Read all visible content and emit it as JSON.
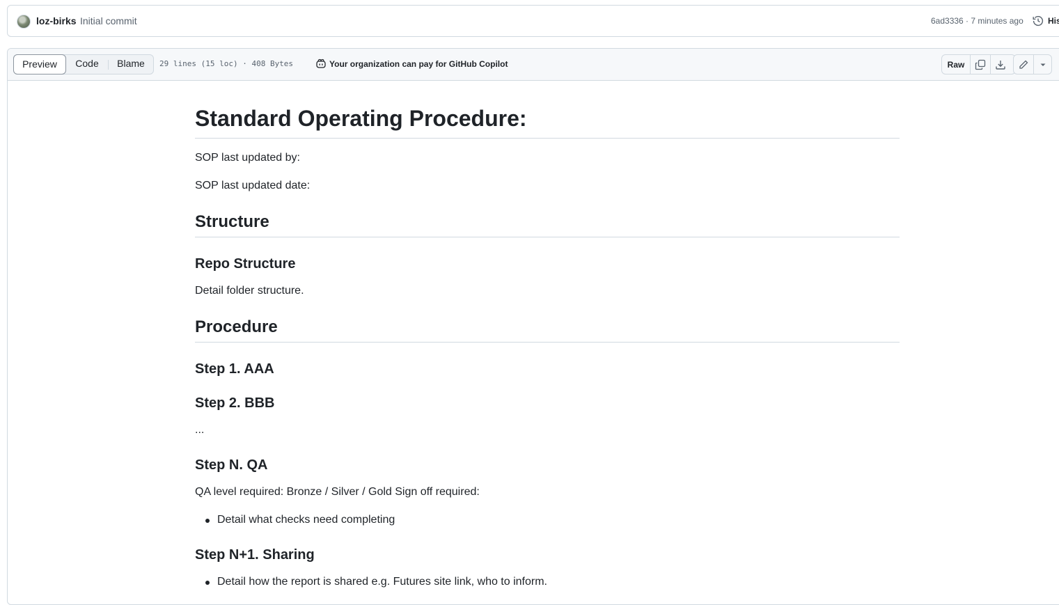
{
  "commit": {
    "author": "loz-birks",
    "message": "Initial commit",
    "meta": "6ad3336 · 7 minutes ago",
    "history_label": "History"
  },
  "file_header": {
    "tabs": [
      "Preview",
      "Code",
      "Blame"
    ],
    "active_tab": "Preview",
    "info": "29 lines (15 loc) · 408 Bytes",
    "copilot_text": "Your organization can pay for GitHub Copilot",
    "raw_label": "Raw",
    "icons": [
      "copy-icon",
      "download-icon",
      "pencil-icon",
      "triangle-down-icon"
    ]
  },
  "doc": {
    "title": "Standard Operating Procedure:",
    "updated_by": "SOP last updated by:",
    "updated_date": "SOP last updated date:",
    "structure_heading": "Structure",
    "repo_structure_heading": "Repo Structure",
    "repo_structure_text": "Detail folder structure.",
    "procedure_heading": "Procedure",
    "step1": "Step 1. AAA",
    "step2": "Step 2. BBB",
    "ellipsis": "...",
    "stepN": "Step N. QA",
    "qa_text": "QA level required: Bronze / Silver / Gold Sign off required:",
    "qa_bullet": "Detail what checks need completing",
    "stepN1": "Step N+1. Sharing",
    "sharing_bullet": "Detail how the report is shared e.g. Futures site link, who to inform."
  },
  "colors": {
    "text": "#1f2328",
    "muted": "#59636e",
    "border": "#d1d9e0",
    "header_bg": "#f6f8fa"
  }
}
